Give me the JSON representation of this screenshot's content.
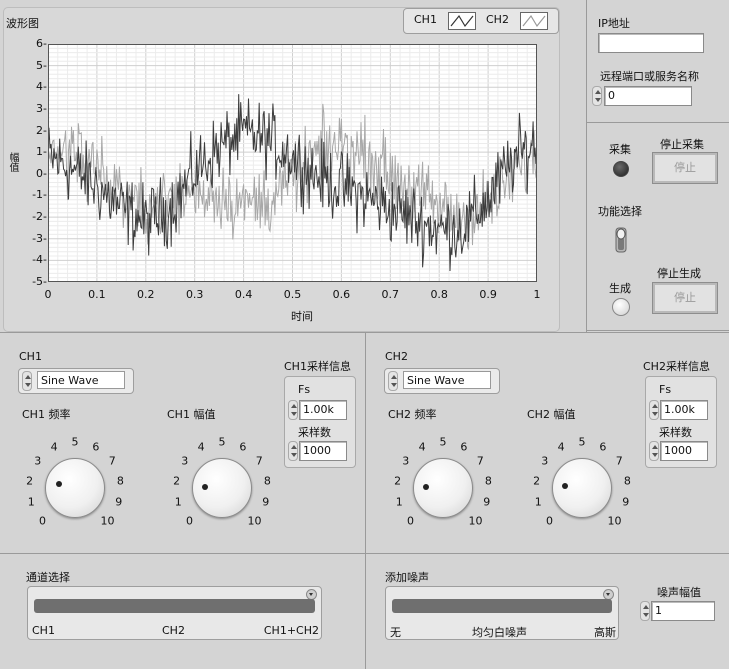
{
  "graph": {
    "title": "波形图",
    "xlabel": "时间",
    "ylabel": "幅值",
    "legend": {
      "ch1": "CH1",
      "ch2": "CH2"
    }
  },
  "chart_data": {
    "type": "line",
    "title": "波形图",
    "xlabel": "时间",
    "ylabel": "幅值",
    "xlim": [
      0,
      1
    ],
    "ylim": [
      -5,
      6
    ],
    "x_ticks": [
      "0",
      "0.1",
      "0.2",
      "0.3",
      "0.4",
      "0.5",
      "0.6",
      "0.7",
      "0.8",
      "0.9",
      "1"
    ],
    "y_ticks": [
      "6",
      "5",
      "4",
      "3",
      "2",
      "1",
      "0",
      "-1",
      "-2",
      "-3",
      "-4",
      "-5"
    ],
    "grid": true,
    "series": [
      {
        "name": "CH1",
        "color": "#3c3c3c",
        "x": [
          0,
          0.05,
          0.1,
          0.15,
          0.2,
          0.25,
          0.3,
          0.35,
          0.4,
          0.45,
          0.5,
          0.55,
          0.6,
          0.65,
          0.7,
          0.75,
          0.8,
          0.85,
          0.9,
          0.95,
          1
        ],
        "values": [
          0.8,
          0.2,
          -0.6,
          -1.6,
          -2.2,
          -1.6,
          0.1,
          1.2,
          1.9,
          1.6,
          0.8,
          -0.1,
          -0.6,
          -1.1,
          -1.6,
          -2.1,
          -2.6,
          -2.5,
          -1.2,
          0.6,
          1.5
        ]
      },
      {
        "name": "CH2",
        "color": "#a8a8a8",
        "x": [
          0,
          0.05,
          0.1,
          0.15,
          0.2,
          0.25,
          0.3,
          0.35,
          0.4,
          0.45,
          0.5,
          0.55,
          0.6,
          0.65,
          0.7,
          0.75,
          0.8,
          0.85,
          0.9,
          0.95,
          1
        ],
        "values": [
          1.2,
          1.0,
          0.2,
          -0.8,
          -1.5,
          -1.2,
          -0.8,
          -0.9,
          -1.4,
          -1.2,
          -0.2,
          0.9,
          1.4,
          0.8,
          0.0,
          -0.8,
          -1.6,
          -2.1,
          -1.4,
          0.0,
          0.8
        ]
      }
    ]
  },
  "network": {
    "ip_label": "IP地址",
    "ip_value": "",
    "port_label": "远程端口或服务名称",
    "port_value": "0"
  },
  "control": {
    "acquire_label": "采集",
    "stop_acquire_label": "停止采集",
    "stop_button": "停止",
    "function_label": "功能选择",
    "generate_label": "生成",
    "stop_generate_label": "停止生成",
    "stop_button2": "停止"
  },
  "ch1": {
    "label": "CH1",
    "waveform": "Sine Wave",
    "freq_label": "CH1 频率",
    "amp_label": "CH1 幅值",
    "freq_value": 2.2,
    "amp_value": 1.8,
    "sample_info_label": "CH1采样信息",
    "fs_label": "Fs",
    "fs_value": "1.00k",
    "samples_label": "采样数",
    "samples_value": "1000"
  },
  "ch2": {
    "label": "CH2",
    "waveform": "Sine Wave",
    "freq_label": "CH2 频率",
    "amp_label": "CH2 幅值",
    "freq_value": 1.8,
    "amp_value": 1.9,
    "sample_info_label": "CH2采样信息",
    "fs_label": "Fs",
    "fs_value": "1.00k",
    "samples_label": "采样数",
    "samples_value": "1000"
  },
  "knob_scale": [
    "0",
    "1",
    "2",
    "3",
    "4",
    "5",
    "6",
    "7",
    "8",
    "9",
    "10"
  ],
  "channel_select": {
    "label": "通道选择",
    "options": [
      "CH1",
      "CH2",
      "CH1+CH2"
    ]
  },
  "noise": {
    "label": "添加噪声",
    "options": [
      "无",
      "均匀白噪声",
      "高斯"
    ],
    "amp_label": "噪声幅值",
    "amp_value": "1"
  }
}
